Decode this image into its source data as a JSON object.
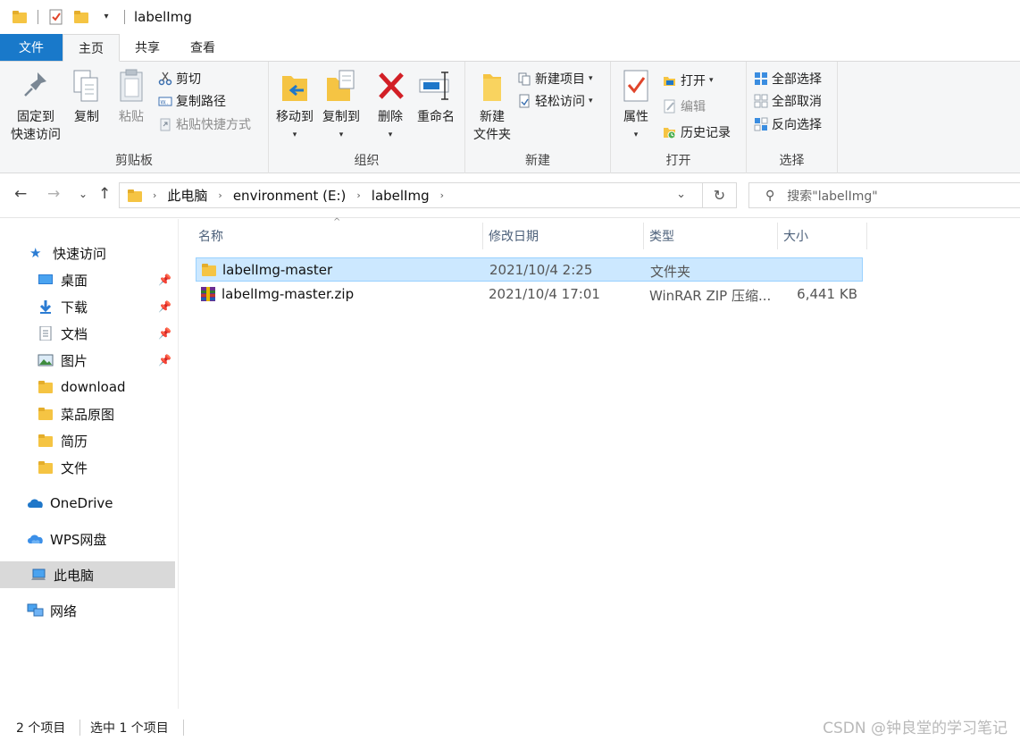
{
  "window": {
    "title": "labelImg"
  },
  "tabs": [
    "文件",
    "主页",
    "共享",
    "查看"
  ],
  "ribbon": {
    "clipboard": {
      "label": "剪贴板",
      "pin_line1": "固定到",
      "pin_line2": "快速访问",
      "copy": "复制",
      "paste": "粘贴",
      "cut": "剪切",
      "copy_path": "复制路径",
      "paste_shortcut": "粘贴快捷方式"
    },
    "organize": {
      "label": "组织",
      "move_to": "移动到",
      "copy_to": "复制到",
      "delete": "删除",
      "rename": "重命名"
    },
    "new": {
      "label": "新建",
      "new_folder_line1": "新建",
      "new_folder_line2": "文件夹",
      "new_item": "新建项目",
      "easy_access": "轻松访问"
    },
    "open": {
      "label": "打开",
      "properties": "属性",
      "open": "打开",
      "edit": "编辑",
      "history": "历史记录"
    },
    "select": {
      "label": "选择",
      "select_all": "全部选择",
      "select_none": "全部取消",
      "invert": "反向选择"
    }
  },
  "address": {
    "crumbs": [
      "此电脑",
      "environment (E:)",
      "labelImg"
    ],
    "search_placeholder": "搜索\"labelImg\""
  },
  "nav": {
    "quick_access": "快速访问",
    "items": [
      {
        "label": "桌面",
        "icon": "desktop-icon",
        "pinned": true
      },
      {
        "label": "下载",
        "icon": "download-arrow-icon",
        "pinned": true
      },
      {
        "label": "文档",
        "icon": "document-icon",
        "pinned": true
      },
      {
        "label": "图片",
        "icon": "pictures-icon",
        "pinned": true
      },
      {
        "label": "download",
        "icon": "folder-icon",
        "pinned": false
      },
      {
        "label": "菜品原图",
        "icon": "folder-icon",
        "pinned": false
      },
      {
        "label": "简历",
        "icon": "folder-icon",
        "pinned": false
      },
      {
        "label": "文件",
        "icon": "folder-icon",
        "pinned": false
      }
    ],
    "onedrive": "OneDrive",
    "wps": "WPS网盘",
    "this_pc": "此电脑",
    "network": "网络"
  },
  "columns": [
    "名称",
    "修改日期",
    "类型",
    "大小"
  ],
  "files": [
    {
      "name": "labelImg-master",
      "date": "2021/10/4 2:25",
      "type": "文件夹",
      "size": "",
      "icon": "folder-icon",
      "selected": true
    },
    {
      "name": "labelImg-master.zip",
      "date": "2021/10/4 17:01",
      "type": "WinRAR ZIP 压缩...",
      "size": "6,441 KB",
      "icon": "winrar-archive-icon",
      "selected": false
    }
  ],
  "status": {
    "count": "2 个项目",
    "selected": "选中 1 个项目"
  },
  "watermark": "CSDN @钟良堂的学习笔记",
  "colors": {
    "accent": "#1979ca",
    "selection": "#cce8ff",
    "folder": "#f5c443"
  }
}
